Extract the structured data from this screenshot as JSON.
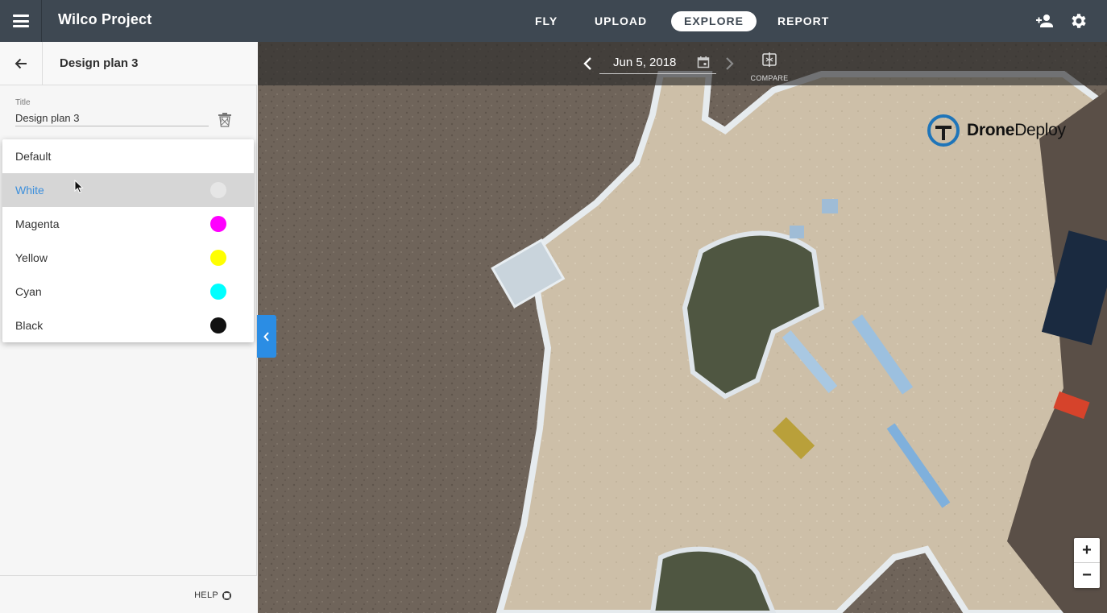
{
  "header": {
    "project_title": "Wilco Project",
    "tabs": [
      {
        "label": "FLY",
        "active": false
      },
      {
        "label": "UPLOAD",
        "active": false
      },
      {
        "label": "EXPLORE",
        "active": true
      },
      {
        "label": "REPORT",
        "active": false
      }
    ],
    "icons": [
      "menu-icon",
      "add-person-icon",
      "gear-icon"
    ]
  },
  "panel": {
    "title": "Design plan 3",
    "field_label": "Title",
    "title_value": "Design plan 3",
    "color_options": [
      {
        "label": "Default",
        "color": null,
        "selected": false
      },
      {
        "label": "White",
        "color": "#e6e6e6",
        "selected": true
      },
      {
        "label": "Magenta",
        "color": "#ff00ff",
        "selected": false
      },
      {
        "label": "Yellow",
        "color": "#ffff00",
        "selected": false
      },
      {
        "label": "Cyan",
        "color": "#00ffff",
        "selected": false
      },
      {
        "label": "Black",
        "color": "#111111",
        "selected": false
      }
    ],
    "help_label": "HELP"
  },
  "map": {
    "date": "Jun 5, 2018",
    "compare_label": "COMPARE",
    "brand_bold": "Drone",
    "brand_light": "Deploy",
    "zoom_in": "+",
    "zoom_out": "−"
  },
  "colors": {
    "topbar": "#3e4852",
    "accent": "#2b8de4",
    "selected_text": "#3c8fdc"
  }
}
